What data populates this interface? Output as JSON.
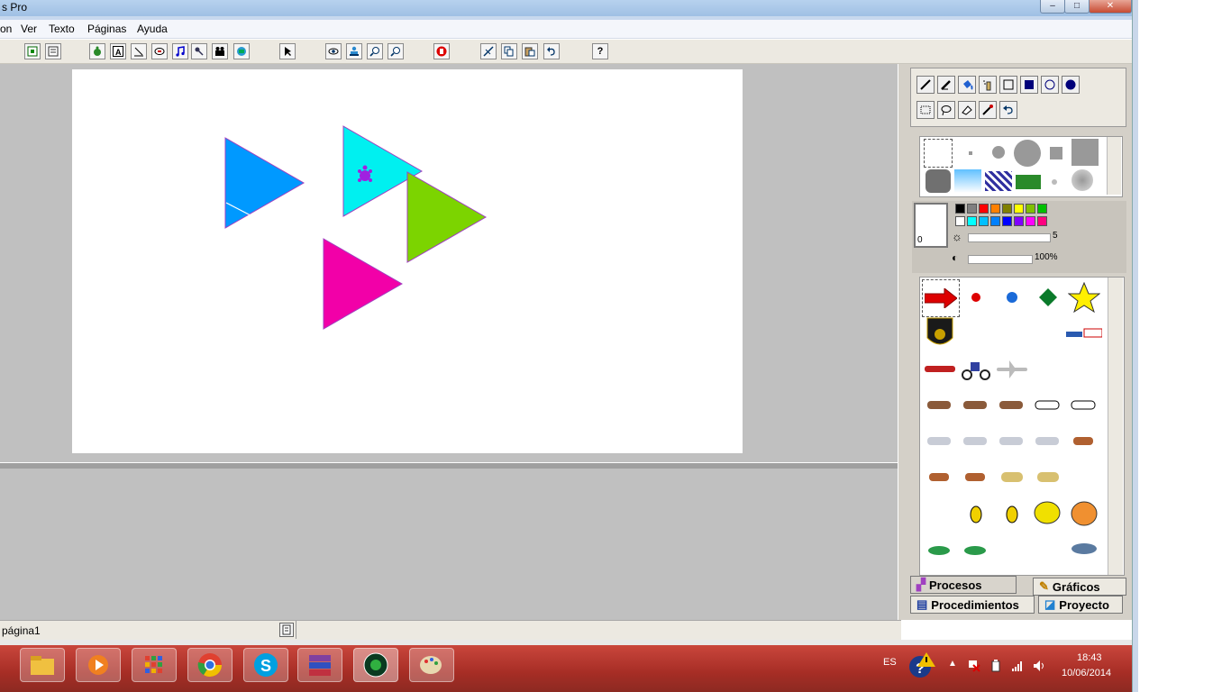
{
  "window": {
    "title": "s Pro",
    "min_glyph": "–",
    "max_glyph": "□",
    "close_glyph": "✕"
  },
  "menu": [
    "on",
    "Ver",
    "Texto",
    "Páginas",
    "Ayuda"
  ],
  "toolbar_icons": [
    "new-page-icon",
    "text-page-icon",
    "turtle-icon",
    "textbox-icon",
    "hatch-icon",
    "button-icon",
    "music-icon",
    "microphone-icon",
    "video-icon",
    "camera-icon",
    "pointer-icon",
    "eye-icon",
    "stamp-icon",
    "zoom-in-icon",
    "zoom-out-icon",
    "stop-icon",
    "cut-icon",
    "copy-icon",
    "paste-icon",
    "undo-icon",
    "help-icon"
  ],
  "toolbar_help_label": "?",
  "canvas": {
    "shapes": [
      {
        "name": "blue-triangle",
        "color": "#0099ff"
      },
      {
        "name": "cyan-triangle",
        "color": "#00f0f0"
      },
      {
        "name": "green-triangle",
        "color": "#7cd400"
      },
      {
        "name": "magenta-triangle",
        "color": "#f200a8"
      }
    ],
    "turtle_color": "#a020e0"
  },
  "status": {
    "page_name": "página1"
  },
  "paint": {
    "tools_row1": [
      "pencil-icon",
      "pen-icon",
      "fill-bucket-icon",
      "spray-icon",
      "rect-outline-icon",
      "rect-fill-icon",
      "ellipse-outline-icon",
      "ellipse-fill-icon"
    ],
    "tools_row2": [
      "select-rect-icon",
      "lasso-icon",
      "eraser-icon",
      "eyedropper-icon",
      "undo-paint-icon"
    ],
    "current_color_value": "0",
    "pen_size": "5",
    "opacity": "100%",
    "palette_top": [
      "#000000",
      "#808080",
      "#ff0000",
      "#ff8000",
      "#808000",
      "#ffff00",
      "#80c000",
      "#00c000"
    ],
    "palette_bottom": [
      "#ffffff",
      "#00ffff",
      "#00c0ff",
      "#0080ff",
      "#0000ff",
      "#8000ff",
      "#ff00ff",
      "#ff0080"
    ]
  },
  "tabs": {
    "procesos": "Procesos",
    "graficos": "Gráficos",
    "procedimientos": "Procedimientos",
    "proyecto": "Proyecto"
  },
  "taskbar": {
    "language": "ES",
    "time": "18:43",
    "date": "10/06/2014",
    "apps": [
      "folder-icon",
      "media-player-icon",
      "apps-grid-icon",
      "chrome-icon",
      "skype-icon",
      "winrar-icon",
      "microworlds-icon",
      "paint-icon"
    ]
  }
}
